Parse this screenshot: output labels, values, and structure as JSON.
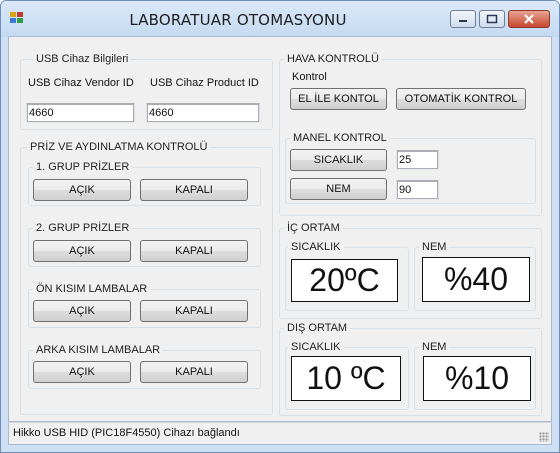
{
  "window": {
    "title": "LABORATUAR OTOMASYONU",
    "icon": "app-icon"
  },
  "usb": {
    "group_label": "USB Cihaz Bilgileri",
    "vendor_label": "USB Cihaz Vendor ID",
    "vendor_value": "4660",
    "product_label": "USB Cihaz Product ID",
    "product_value": "4660"
  },
  "priz": {
    "group_label": "PRİZ VE AYDINLATMA KONTROLÜ",
    "groups": [
      {
        "label": "1. GRUP PRİZLER",
        "on": "AÇIK",
        "off": "KAPALI"
      },
      {
        "label": "2. GRUP PRİZLER",
        "on": "AÇIK",
        "off": "KAPALI"
      },
      {
        "label": "ÖN KISIM LAMBALAR",
        "on": "AÇIK",
        "off": "KAPALI"
      },
      {
        "label": "ARKA KISIM LAMBALAR",
        "on": "AÇIK",
        "off": "KAPALI"
      }
    ]
  },
  "hava": {
    "group_label": "HAVA KONTROLÜ",
    "kontrol_label": "Kontrol",
    "manual_button": "EL İLE KONTOL",
    "auto_button": "OTOMATİK KONTROL",
    "manel": {
      "group_label": "MANEL KONTROL",
      "temp_button": "SICAKLIK",
      "temp_value": "25",
      "hum_button": "NEM",
      "hum_value": "90"
    }
  },
  "ic_ortam": {
    "group_label": "İÇ ORTAM",
    "temp_label": "SICAKLIK",
    "temp_value": "20ºC",
    "hum_label": "NEM",
    "hum_value": "%40"
  },
  "dis_ortam": {
    "group_label": "DIŞ ORTAM",
    "temp_label": "SICAKLIK",
    "temp_value": "10 ºC",
    "hum_label": "NEM",
    "hum_value": "%10"
  },
  "status": {
    "text": "Hikko USB HID (PIC18F4550) Cihazı bağlandı"
  }
}
